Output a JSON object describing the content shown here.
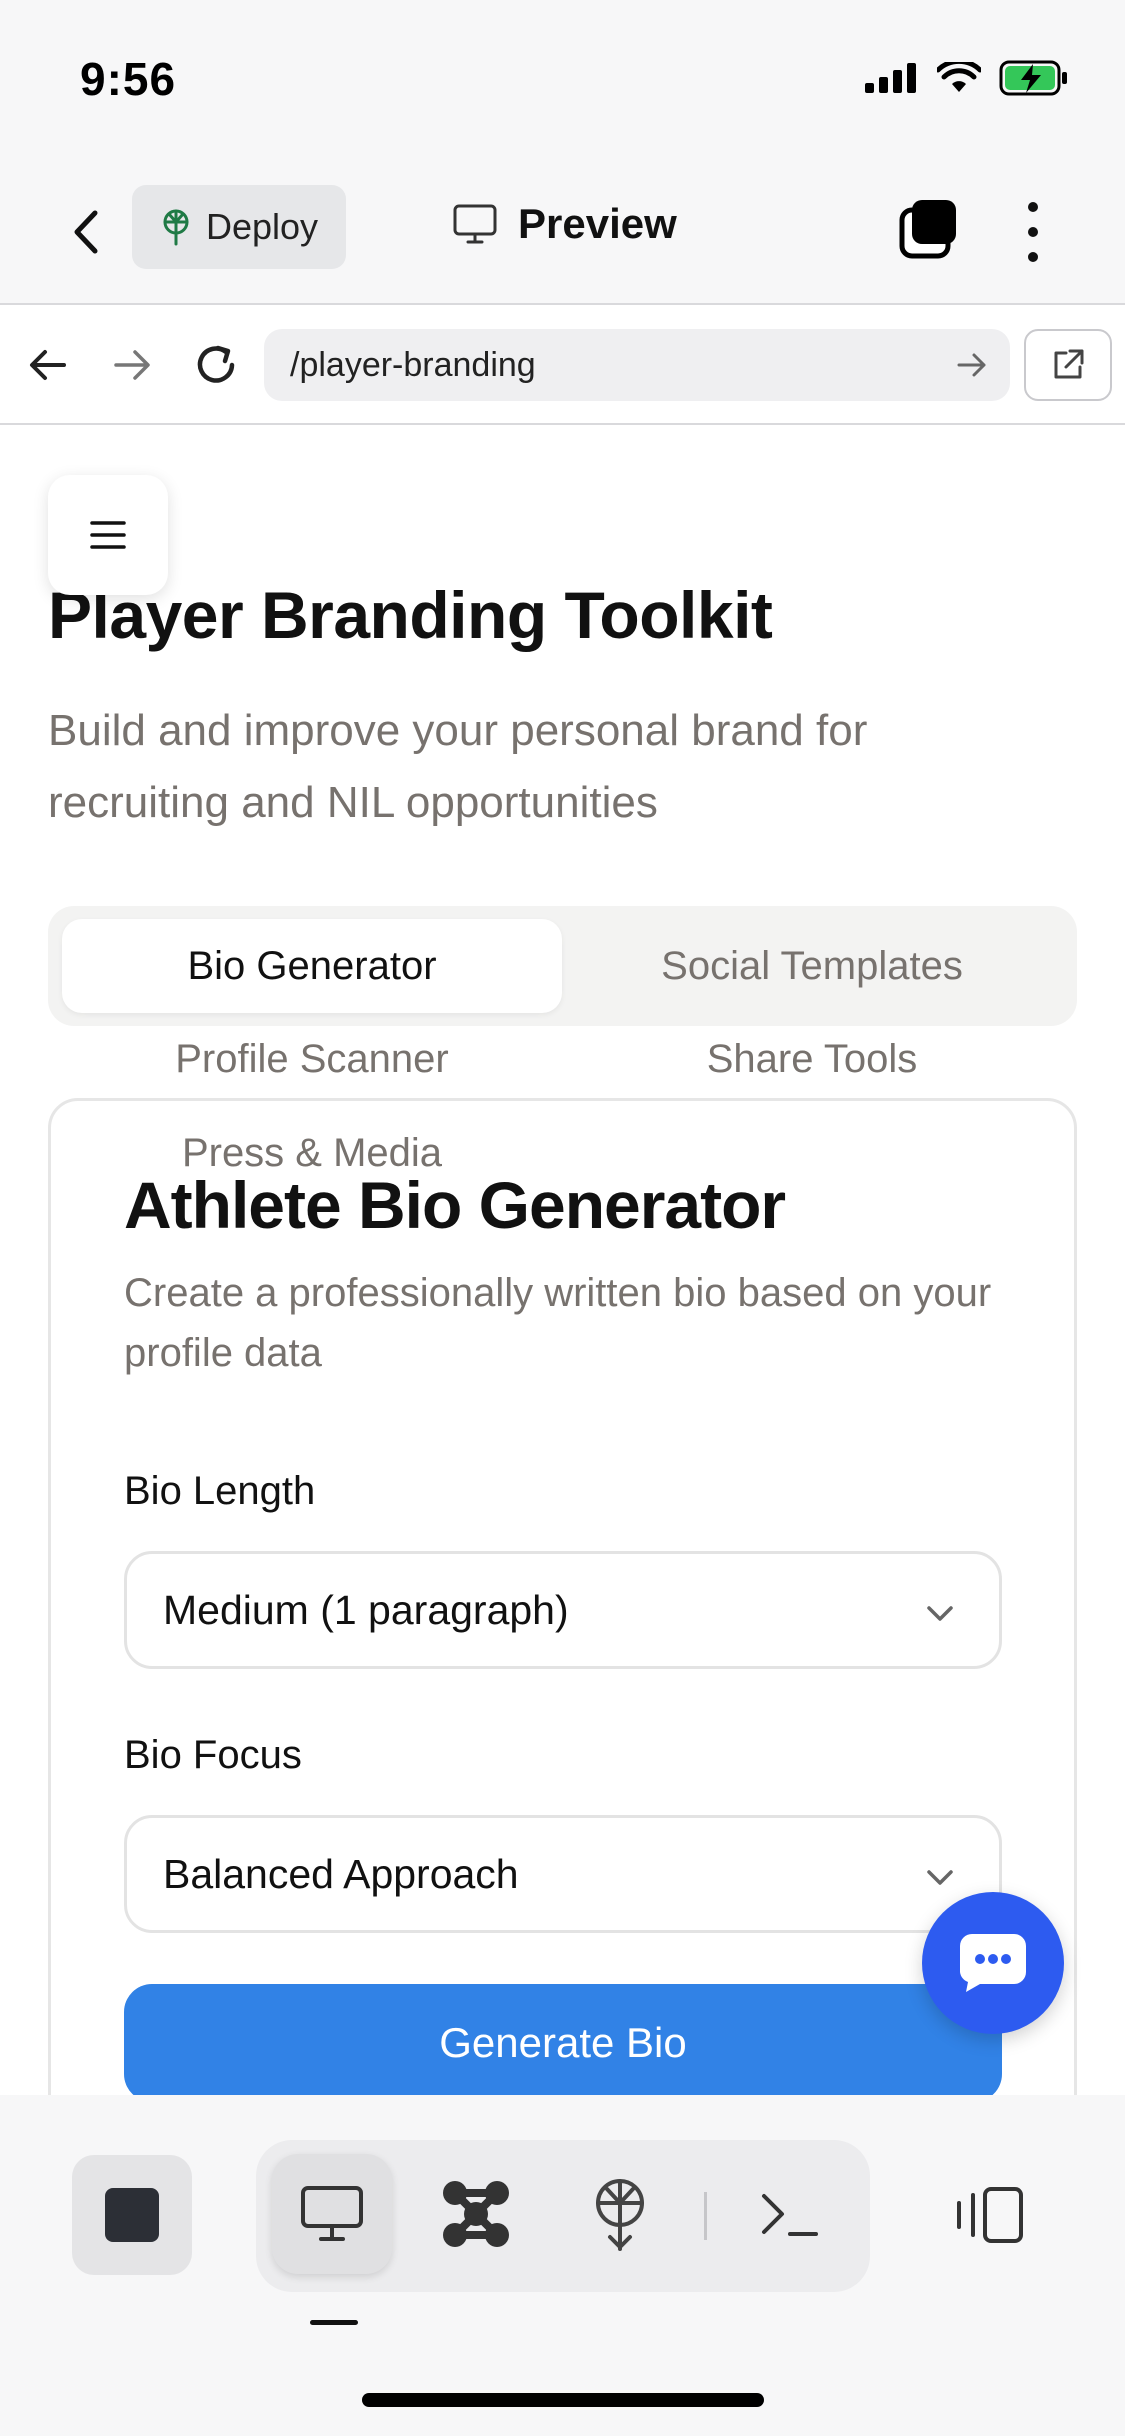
{
  "status_bar": {
    "time": "9:56"
  },
  "app_bar": {
    "deploy_label": "Deploy",
    "preview_label": "Preview"
  },
  "browser": {
    "url": "/player-branding"
  },
  "page": {
    "title": "Player Branding Toolkit",
    "subtitle": "Build and improve your personal brand for recruiting and NIL opportunities",
    "tabs": [
      {
        "label": "Bio Generator",
        "active": true
      },
      {
        "label": "Social Templates",
        "active": false
      },
      {
        "label": "Profile Scanner",
        "active": false
      },
      {
        "label": "Share Tools",
        "active": false
      },
      {
        "label": "Press & Media",
        "active": false
      }
    ]
  },
  "bio_card": {
    "title": "Athlete Bio Generator",
    "description": "Create a professionally written bio based on your profile data",
    "bio_length_label": "Bio Length",
    "bio_length_value": "Medium (1 paragraph)",
    "bio_focus_label": "Bio Focus",
    "bio_focus_value": "Balanced Approach",
    "generate_label": "Generate Bio"
  },
  "colors": {
    "accent_blue": "#3182e6",
    "chat_fab": "#2d5bf0",
    "battery_green": "#34c759",
    "deploy_icon_green": "#1f7a45"
  }
}
